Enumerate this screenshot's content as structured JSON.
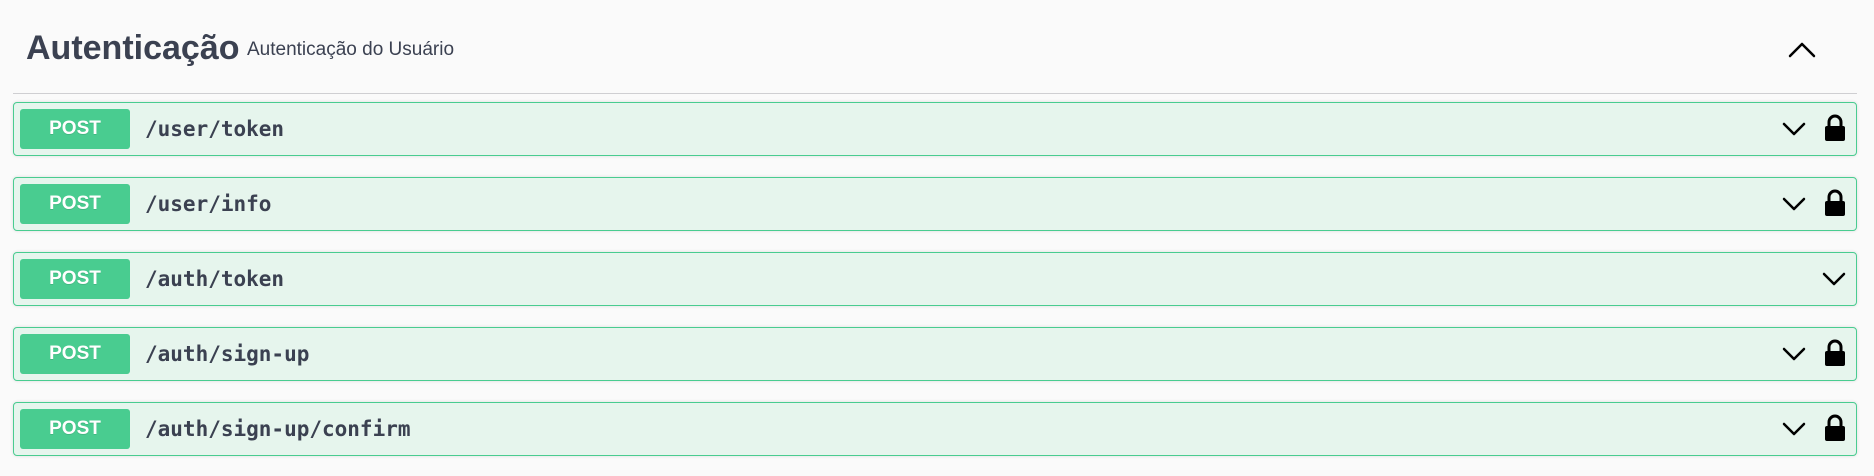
{
  "tag": {
    "title": "Autenticação",
    "description": "Autenticação do Usuário",
    "expanded": true,
    "collapse_icon": "chevron-up-icon"
  },
  "operations": [
    {
      "method": "POST",
      "path": "/user/token",
      "locked": true
    },
    {
      "method": "POST",
      "path": "/user/info",
      "locked": true
    },
    {
      "method": "POST",
      "path": "/auth/token",
      "locked": false
    },
    {
      "method": "POST",
      "path": "/auth/sign-up",
      "locked": true
    },
    {
      "method": "POST",
      "path": "/auth/sign-up/confirm",
      "locked": true
    }
  ],
  "icons": {
    "expand": "chevron-down-icon",
    "auth": "lock-icon"
  },
  "colors": {
    "post_accent": "#49cc90",
    "post_background": "#e6f5ed",
    "text": "#3b4151"
  }
}
